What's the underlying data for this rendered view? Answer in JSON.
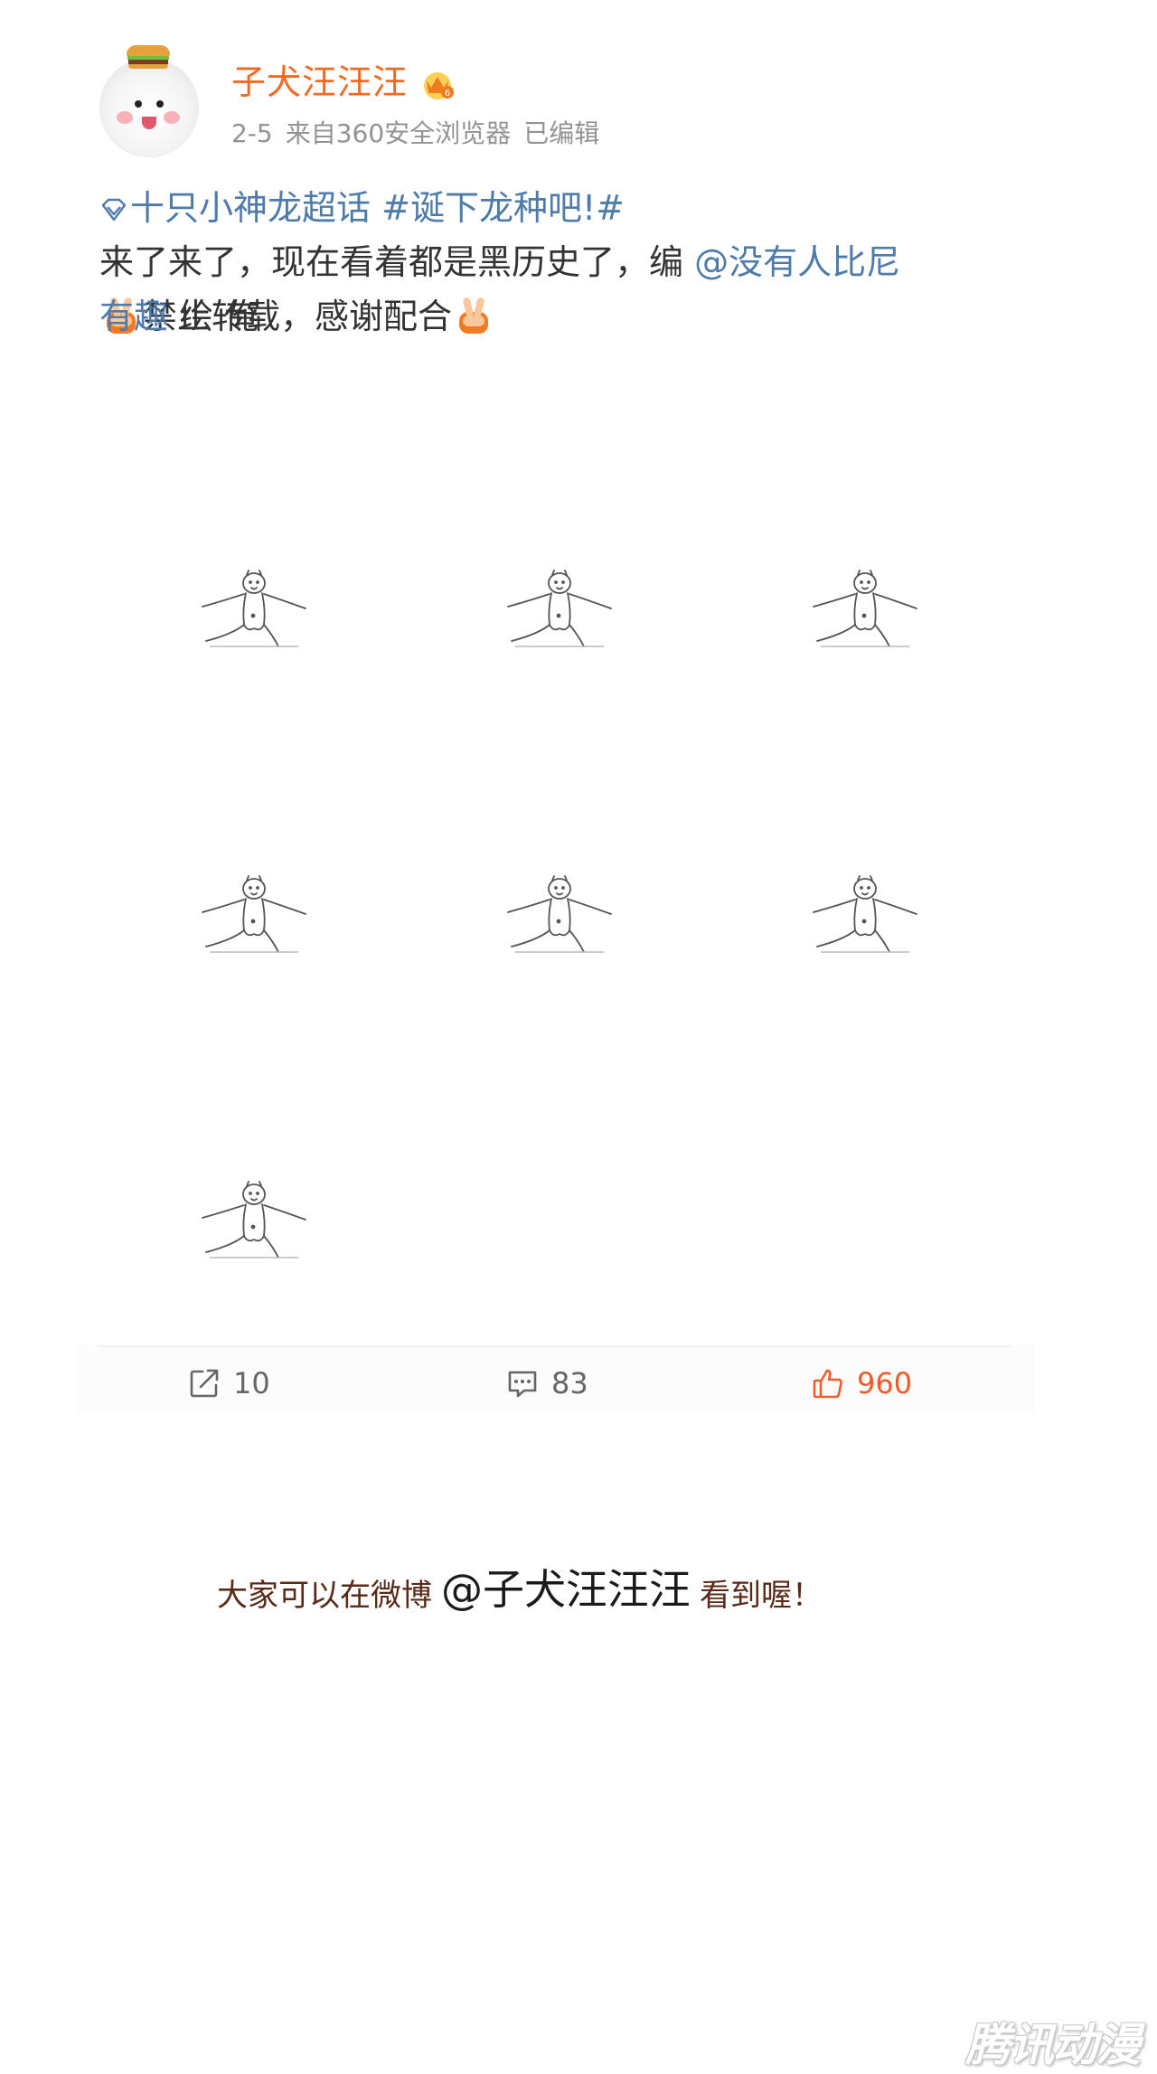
{
  "post": {
    "author": "子犬汪汪汪",
    "time": "2-5",
    "source": "来自360安全浏览器",
    "edited": "已编辑",
    "topic": "十只小神龙超话",
    "hashtag": "#诞下龙种吧!#",
    "line1_text": "来了来了，现在看着都是黑历史了，编",
    "mention": "@没有人比尼有趣",
    "line2_rest": "绘 俺",
    "line3_text": "禁止转载，感谢配合",
    "image_count": 7
  },
  "actions": {
    "repost_count": "10",
    "comment_count": "83",
    "like_count": "960"
  },
  "footer": {
    "prefix": "大家可以在微博",
    "handle": "@子犬汪汪汪",
    "suffix": "看到喔！"
  },
  "colors": {
    "username": "#f16922",
    "link": "#4f7bab",
    "like": "#f25a29",
    "meta": "#939393"
  }
}
